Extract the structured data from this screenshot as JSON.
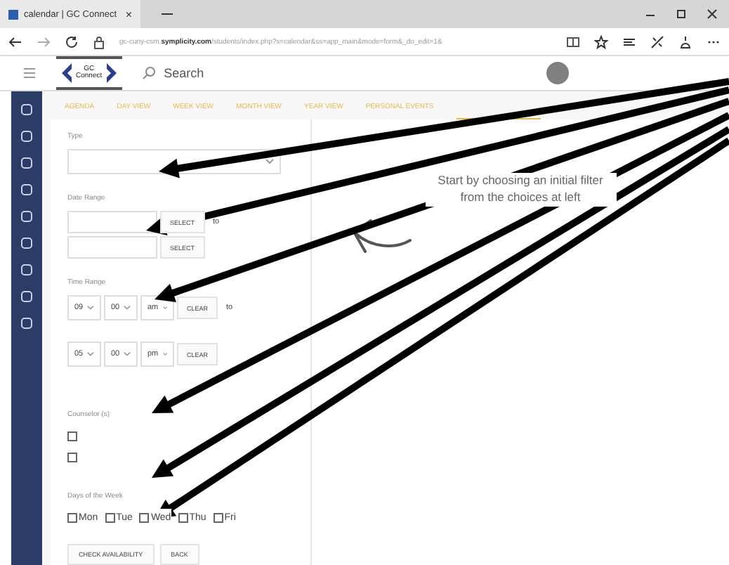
{
  "browser": {
    "tab_title": "calendar | GC Connect",
    "tab_close": "×",
    "url_prefix": "gc-cuny-csm.",
    "url_domain": "symplicity.com",
    "url_path": "/students/index.php?s=calendar&ss=app_main&mode=form&_do_edit=1&"
  },
  "header": {
    "logo_top": "GC",
    "logo_bottom": "Connect",
    "search_placeholder": "Search"
  },
  "nav_tabs": [
    {
      "label": "AGENDA",
      "selected": false
    },
    {
      "label": "DAY VIEW",
      "selected": false
    },
    {
      "label": "WEEK VIEW",
      "selected": false
    },
    {
      "label": "MONTH VIEW",
      "selected": false
    },
    {
      "label": "YEAR VIEW",
      "selected": false
    },
    {
      "label": "PERSONAL EVENTS",
      "selected": false
    },
    {
      "selected": true
    }
  ],
  "form": {
    "type_label": "Type",
    "date_label": "Date Range",
    "date_rows": [
      {
        "button": "SELECT",
        "suffix": "to"
      },
      {
        "button": "SELECT"
      }
    ],
    "time_label": "Time Range",
    "time_rows": [
      {
        "hour": "09",
        "minute": "00",
        "ampm": "am",
        "button": "CLEAR",
        "suffix": "to"
      },
      {
        "hour": "05",
        "minute": "00",
        "ampm": "pm",
        "button": "CLEAR"
      }
    ],
    "counselor_label": "Counselor (s)",
    "counselors": [
      {
        "checked": false
      },
      {
        "checked": false
      }
    ],
    "days_label": "Days of the Week",
    "days": [
      {
        "label": "Mon",
        "checked": false
      },
      {
        "label": "Tue",
        "checked": false
      },
      {
        "label": "Wed",
        "checked": false
      },
      {
        "label": "Thu",
        "checked": false
      },
      {
        "label": "Fri",
        "checked": false
      }
    ],
    "buttons": [
      "CHECK AVAILABILITY",
      "BACK"
    ]
  },
  "message": "Start by choosing an initial filter from the choices at left"
}
